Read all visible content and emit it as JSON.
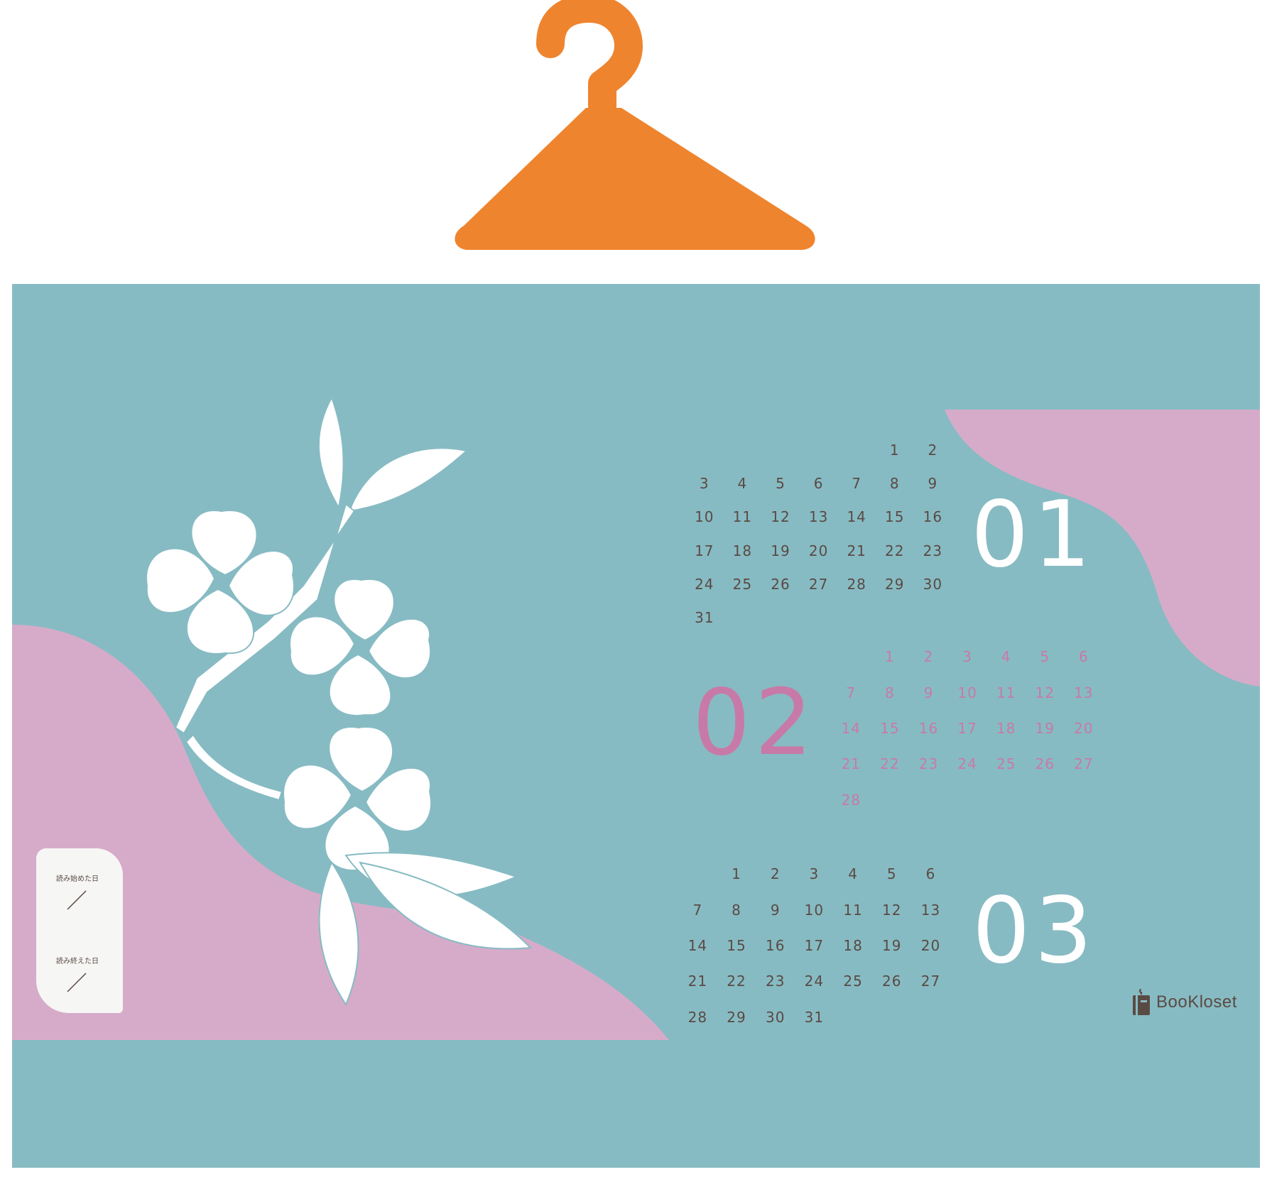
{
  "colors": {
    "hanger": "#ef842e",
    "background": "#87bbc3",
    "accent_pink": "#d6abc9",
    "month_02": "#c77aa8",
    "text": "#5a4a44"
  },
  "icons": [
    "hanger-icon",
    "dogwood-flower-icon",
    "book-icon"
  ],
  "calendar": {
    "m01": {
      "number": "01",
      "leading_blanks": 5,
      "days": [
        "1",
        "2",
        "3",
        "4",
        "5",
        "6",
        "7",
        "8",
        "9",
        "10",
        "11",
        "12",
        "13",
        "14",
        "15",
        "16",
        "17",
        "18",
        "19",
        "20",
        "21",
        "22",
        "23",
        "24",
        "25",
        "26",
        "27",
        "28",
        "29",
        "30",
        "31"
      ]
    },
    "m02": {
      "number": "02",
      "leading_blanks": 1,
      "days": [
        "1",
        "2",
        "3",
        "4",
        "5",
        "6",
        "7",
        "8",
        "9",
        "10",
        "11",
        "12",
        "13",
        "14",
        "15",
        "16",
        "17",
        "18",
        "19",
        "20",
        "21",
        "22",
        "23",
        "24",
        "25",
        "26",
        "27",
        "28"
      ]
    },
    "m03": {
      "number": "03",
      "leading_blanks": 1,
      "days": [
        "1",
        "2",
        "3",
        "4",
        "5",
        "6",
        "7",
        "8",
        "9",
        "10",
        "11",
        "12",
        "13",
        "14",
        "15",
        "16",
        "17",
        "18",
        "19",
        "20",
        "21",
        "22",
        "23",
        "24",
        "25",
        "26",
        "27",
        "28",
        "29",
        "30",
        "31"
      ]
    }
  },
  "card": {
    "start_label": "読み始めた日",
    "end_label": "読み終えた日"
  },
  "logo": {
    "text": "BooKloset"
  }
}
